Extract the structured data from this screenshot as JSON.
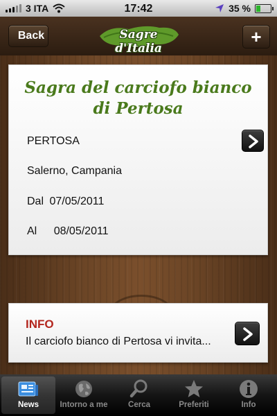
{
  "status_bar": {
    "carrier": "3 ITA",
    "time": "17:42",
    "battery": "35 %",
    "battery_level": 0.35
  },
  "nav_bar": {
    "back_label": "Back",
    "add_label": "+",
    "logo_text": "Sagre d'Italia"
  },
  "event": {
    "title": "Sagra del carciofo bianco di Pertosa",
    "location": "PERTOSA",
    "province_region": "Salerno, Campania",
    "from_label": "Dal",
    "from_date": "07/05/2011",
    "to_label": "Al",
    "to_date": "08/05/2011"
  },
  "info": {
    "title": "INFO",
    "text": "Il carciofo bianco di Pertosa vi invita..."
  },
  "tab_bar": {
    "tabs": [
      {
        "label": "News",
        "icon": "news-icon",
        "active": true
      },
      {
        "label": "Intorno a me",
        "icon": "globe-icon",
        "active": false
      },
      {
        "label": "Cerca",
        "icon": "magnifier-icon",
        "active": false
      },
      {
        "label": "Preferiti",
        "icon": "star-icon",
        "active": false
      },
      {
        "label": "Info",
        "icon": "info-icon",
        "active": false
      }
    ]
  },
  "colors": {
    "title_green": "#4a7a1c",
    "info_red": "#b3261e",
    "wood": "#6b4526"
  }
}
